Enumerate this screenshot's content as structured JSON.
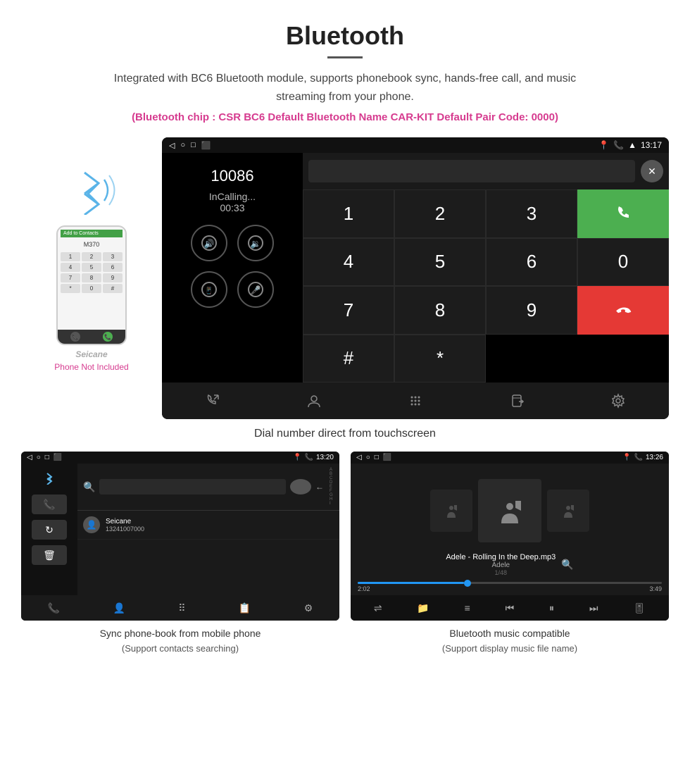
{
  "header": {
    "title": "Bluetooth",
    "description": "Integrated with BC6 Bluetooth module, supports phonebook sync, hands-free call, and music streaming from your phone.",
    "specs": "(Bluetooth chip : CSR BC6    Default Bluetooth Name CAR-KIT    Default Pair Code: 0000)"
  },
  "main_screen": {
    "status_bar": {
      "left_icons": [
        "◁",
        "○",
        "□",
        "⬛"
      ],
      "right_icons": [
        "📍",
        "📞",
        "▲"
      ],
      "time": "13:17"
    },
    "call": {
      "number": "10086",
      "status": "InCalling...",
      "timer": "00:33"
    },
    "dialpad": {
      "keys": [
        "1",
        "2",
        "3",
        "*",
        "4",
        "5",
        "6",
        "0",
        "7",
        "8",
        "9",
        "#"
      ]
    },
    "nav_icons": [
      "📞",
      "👤",
      "⠿",
      "📋",
      "⚙"
    ]
  },
  "caption_main": "Dial number direct from touchscreen",
  "phonebook_screen": {
    "status_bar": {
      "time": "13:20"
    },
    "contact": {
      "name": "Seicane",
      "phone": "13241007000"
    },
    "alpha_list": [
      "A",
      "B",
      "C",
      "D",
      "E",
      "F",
      "G",
      "H",
      "I"
    ],
    "back_arrow": "←"
  },
  "music_screen": {
    "status_bar": {
      "time": "13:26"
    },
    "track": {
      "title": "Adele - Rolling In the Deep.mp3",
      "artist": "Adele",
      "position": "1/48"
    },
    "time_current": "2:02",
    "time_total": "3:49",
    "progress_percent": 35
  },
  "caption_phonebook": {
    "main": "Sync phone-book from mobile phone",
    "sub": "(Support contacts searching)"
  },
  "caption_music": {
    "main": "Bluetooth music compatible",
    "sub": "(Support display music file name)"
  },
  "phone_not_included": "Phone Not Included",
  "seicane_logo": "Seicane"
}
